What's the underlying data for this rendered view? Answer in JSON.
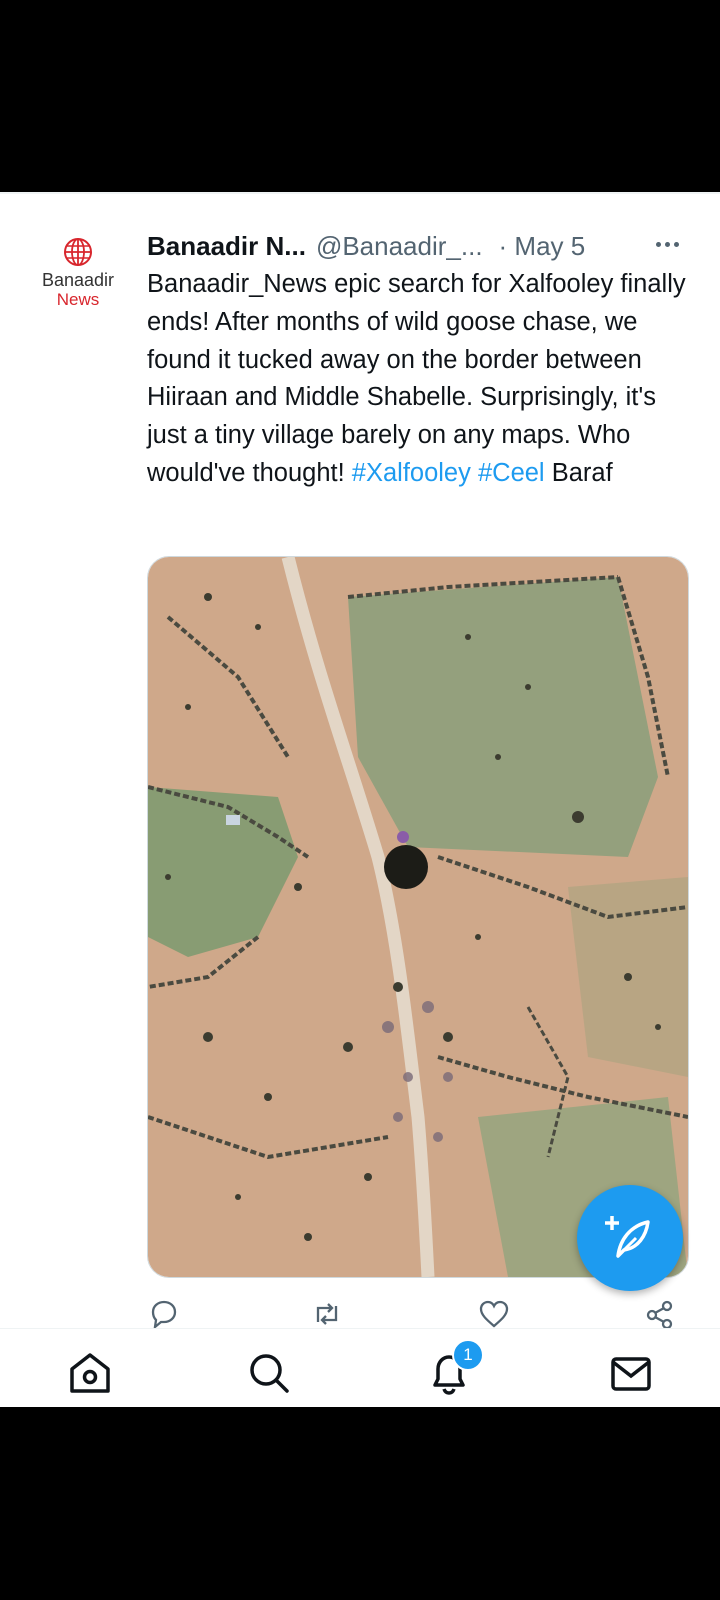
{
  "post": {
    "author_name": "Banaadir N...",
    "author_handle": "@Banaadir_...",
    "date": "· May 5",
    "avatar": {
      "line1": "Banaadir",
      "line2": "News",
      "icon": "globe-icon"
    },
    "text_plain": "Banaadir_News epic search for Xalfooley finally ends! After months of wild goose chase, we found it tucked away on the border between Hiiraan and Middle Shabelle. Surprisingly, it's just a tiny village barely on any maps. Who would've thought!",
    "hashtag1": "#Xalfooley",
    "hashtag2": "#Ceel",
    "text_tail": "Baraf",
    "media_icon": "satellite-photo"
  },
  "actions": [
    "reply-icon",
    "repost-icon",
    "like-icon",
    "share-icon"
  ],
  "nav": {
    "items": [
      "home-icon",
      "search-icon",
      "notifications-icon",
      "messages-icon"
    ],
    "notifications_badge": "1"
  },
  "fab": {
    "icon": "compose-icon"
  },
  "colors": {
    "accent": "#1d9bf0",
    "text": "#0f1419",
    "muted": "#536471",
    "brand_red": "#d8262d"
  }
}
